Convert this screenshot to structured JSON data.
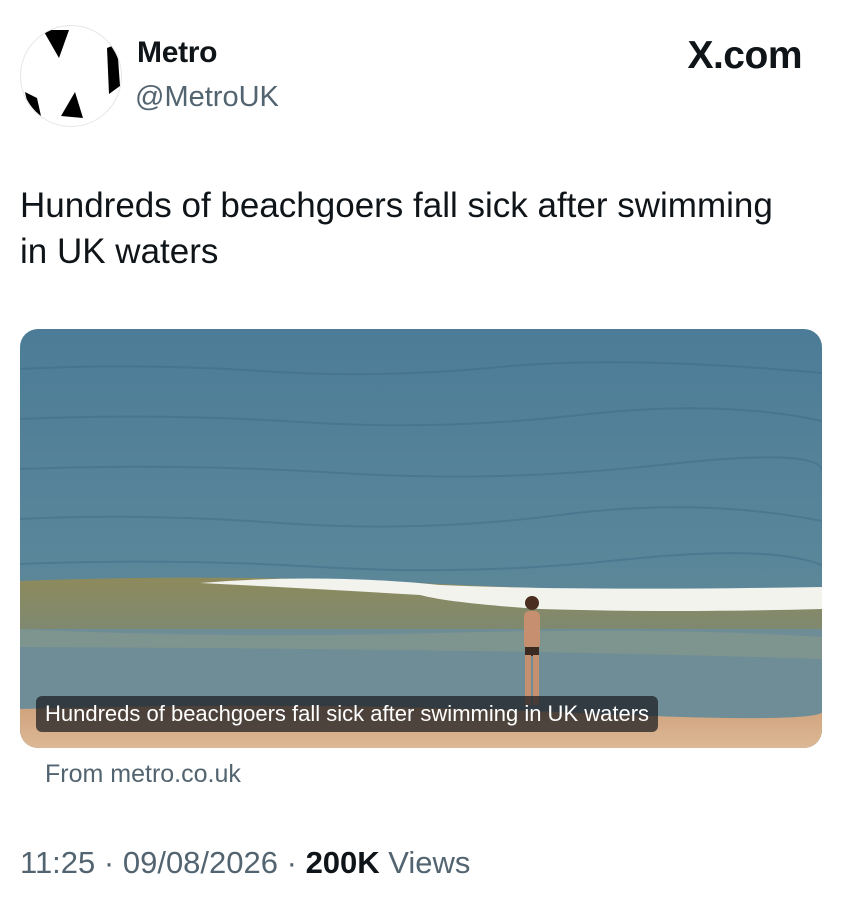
{
  "author": {
    "display_name": "Metro",
    "handle": "@MetroUK",
    "avatar_icon": "metro-logo-icon"
  },
  "platform_logo": "X.com",
  "tweet": {
    "text": "Hundreds of beachgoers fall sick after swimming in UK waters"
  },
  "card": {
    "image_icon": "beach-photo",
    "caption": "Hundreds of beachgoers fall sick after swimming in UK waters",
    "source": "From metro.co.uk"
  },
  "meta": {
    "time": "11:25",
    "separator": " · ",
    "date": "09/08/2026",
    "views_count": "200K",
    "views_label": " Views"
  },
  "colors": {
    "text_primary": "#0f1419",
    "text_secondary": "#536471",
    "sea": "#4f7e97",
    "sand": "#d9b48f"
  }
}
